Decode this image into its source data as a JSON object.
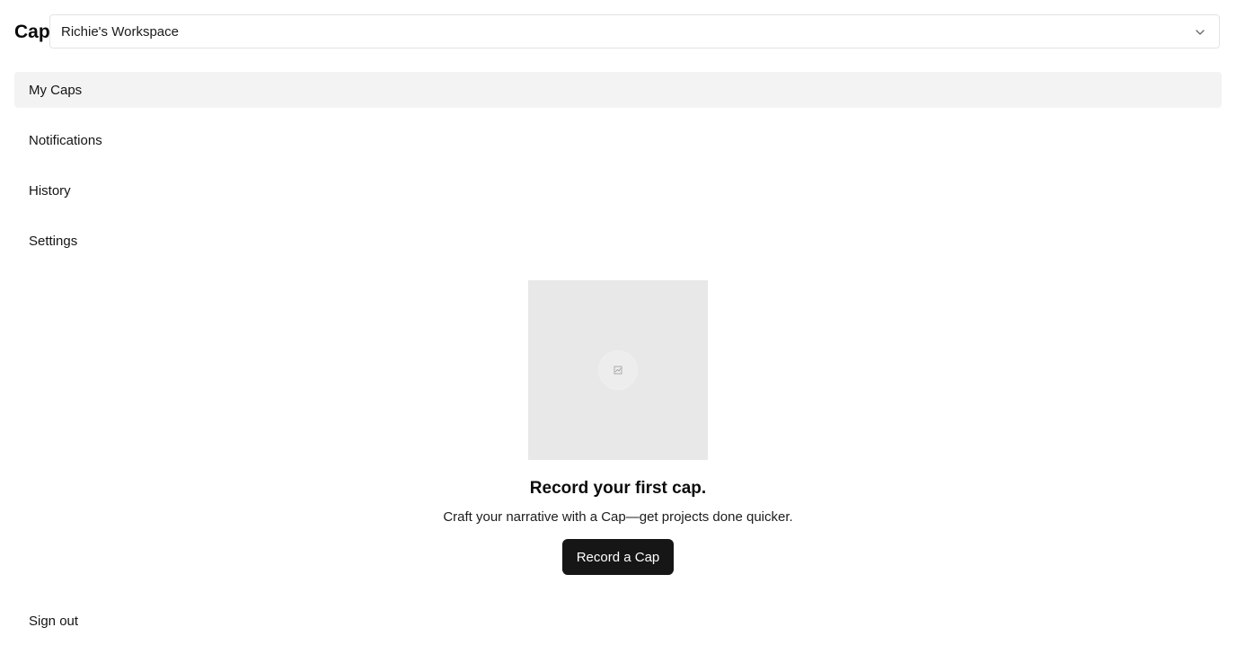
{
  "app": {
    "logo_text": "Cap"
  },
  "workspace": {
    "selected": "Richie's Workspace",
    "chevron_icon": "chevron-down-icon"
  },
  "nav": {
    "items": [
      {
        "label": "My Caps",
        "active": true
      },
      {
        "label": "Notifications",
        "active": false
      },
      {
        "label": "History",
        "active": false
      },
      {
        "label": "Settings",
        "active": false
      }
    ]
  },
  "empty_state": {
    "illustration_icon": "broken-image-icon",
    "title": "Record your first cap.",
    "subtitle": "Craft your narrative with a Cap—get projects done quicker.",
    "button_label": "Record a Cap"
  },
  "footer": {
    "signout_label": "Sign out"
  },
  "colors": {
    "active_nav_bg": "#f3f3f3",
    "button_bg": "#161616",
    "illustration_bg": "#e8e8e8"
  }
}
